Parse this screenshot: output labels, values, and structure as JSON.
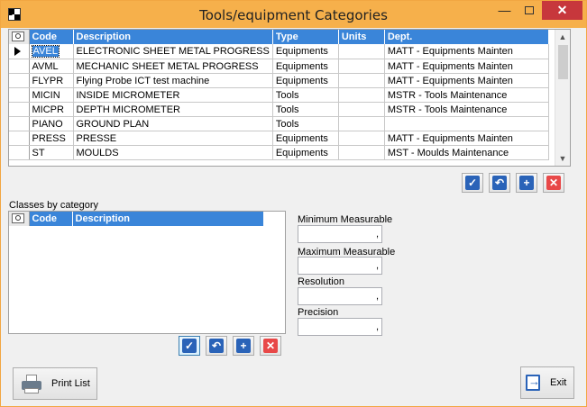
{
  "window": {
    "title": "Tools/equipment Categories"
  },
  "categories_grid": {
    "columns": [
      "Code",
      "Description",
      "Type",
      "Units",
      "Dept."
    ],
    "rows": [
      {
        "code": "AVEL",
        "description": "ELECTRONIC SHEET METAL PROGRESS",
        "type": "Equipments",
        "units": "",
        "dept": "MATT - Equipments Mainten"
      },
      {
        "code": "AVML",
        "description": "MECHANIC SHEET METAL PROGRESS",
        "type": "Equipments",
        "units": "",
        "dept": "MATT - Equipments Mainten"
      },
      {
        "code": "FLYPR",
        "description": "Flying Probe ICT test machine",
        "type": "Equipments",
        "units": "",
        "dept": "MATT - Equipments Mainten"
      },
      {
        "code": "MICIN",
        "description": "INSIDE MICROMETER",
        "type": "Tools",
        "units": "",
        "dept": "MSTR - Tools Maintenance"
      },
      {
        "code": "MICPR",
        "description": "DEPTH MICROMETER",
        "type": "Tools",
        "units": "",
        "dept": "MSTR - Tools Maintenance"
      },
      {
        "code": "PIANO",
        "description": "GROUND PLAN",
        "type": "Tools",
        "units": "",
        "dept": ""
      },
      {
        "code": "PRESS",
        "description": "PRESSE",
        "type": "Equipments",
        "units": "",
        "dept": "MATT - Equipments Mainten"
      },
      {
        "code": "ST",
        "description": "MOULDS",
        "type": "Equipments",
        "units": "",
        "dept": "MST - Moulds Maintenance"
      }
    ]
  },
  "classes": {
    "label": "Classes by category",
    "columns": [
      "Code",
      "Description"
    ]
  },
  "measures": {
    "min_label": "Minimum Measurable",
    "min_value": ",",
    "max_label": "Maximum Measurable",
    "max_value": ",",
    "resolution_label": "Resolution",
    "resolution_value": ",",
    "precision_label": "Precision",
    "precision_value": ","
  },
  "buttons": {
    "print_list": "Print List",
    "exit": "Exit"
  },
  "icons": {
    "confirm": "check-icon",
    "undo": "undo-icon",
    "add": "plus-icon",
    "delete": "x-icon"
  }
}
